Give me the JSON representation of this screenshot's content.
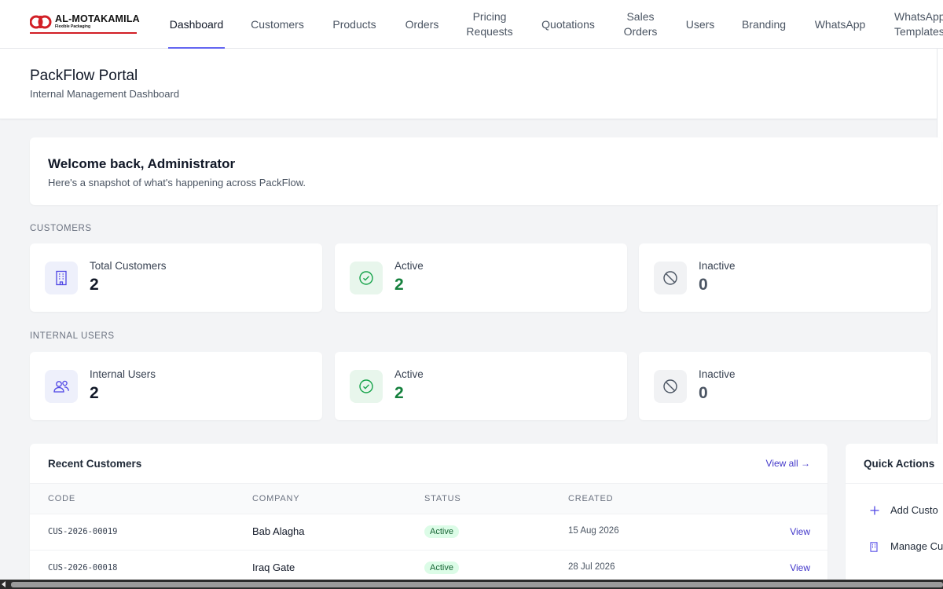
{
  "brand": {
    "name": "AL-MOTAKAMILA",
    "tagline": "Flexible Packaging",
    "color": "#d21f26"
  },
  "nav": {
    "dashboard": "Dashboard",
    "customers": "Customers",
    "products": "Products",
    "orders": "Orders",
    "pricing_1": "Pricing",
    "pricing_2": "Requests",
    "quotations": "Quotations",
    "sales_1": "Sales",
    "sales_2": "Orders",
    "users": "Users",
    "branding": "Branding",
    "whatsapp": "WhatsApp",
    "templates_1": "WhatsApp",
    "templates_2": "Templates",
    "active_accent": "#6366f1"
  },
  "header": {
    "title": "PackFlow Portal",
    "subtitle": "Internal Management Dashboard"
  },
  "welcome": {
    "title": "Welcome back, Administrator",
    "subtitle": "Here's a snapshot of what's happening across PackFlow."
  },
  "customers_section": {
    "label": "CUSTOMERS",
    "total": {
      "label": "Total Customers",
      "value": "2",
      "icon": "building-icon"
    },
    "active": {
      "label": "Active",
      "value": "2",
      "icon": "check-circle-icon"
    },
    "inactive": {
      "label": "Inactive",
      "value": "0",
      "icon": "ban-icon"
    }
  },
  "users_section": {
    "label": "INTERNAL USERS",
    "total": {
      "label": "Internal Users",
      "value": "2",
      "icon": "users-icon"
    },
    "active": {
      "label": "Active",
      "value": "2",
      "icon": "check-circle-icon"
    },
    "inactive": {
      "label": "Inactive",
      "value": "0",
      "icon": "ban-icon"
    }
  },
  "recent": {
    "title": "Recent Customers",
    "view_all": "View all →",
    "columns": {
      "code": "CODE",
      "company": "COMPANY",
      "status": "STATUS",
      "created": "CREATED"
    },
    "rows": [
      {
        "code": "CUS-2026-00019",
        "company": "Bab Alagha",
        "status": "Active",
        "created": "15 Aug 2026",
        "action": "View"
      },
      {
        "code": "CUS-2026-00018",
        "company": "Iraq Gate",
        "status": "Active",
        "created": "28 Jul 2026",
        "action": "View"
      }
    ]
  },
  "quick_actions": {
    "title": "Quick Actions",
    "items": [
      {
        "label": "Add Custo",
        "icon": "plus-icon"
      },
      {
        "label": "Manage Cu",
        "icon": "building-icon"
      }
    ]
  },
  "colors": {
    "accent": "#4338ca",
    "success": "#15803d",
    "success_badge_bg": "#dcfce7"
  }
}
